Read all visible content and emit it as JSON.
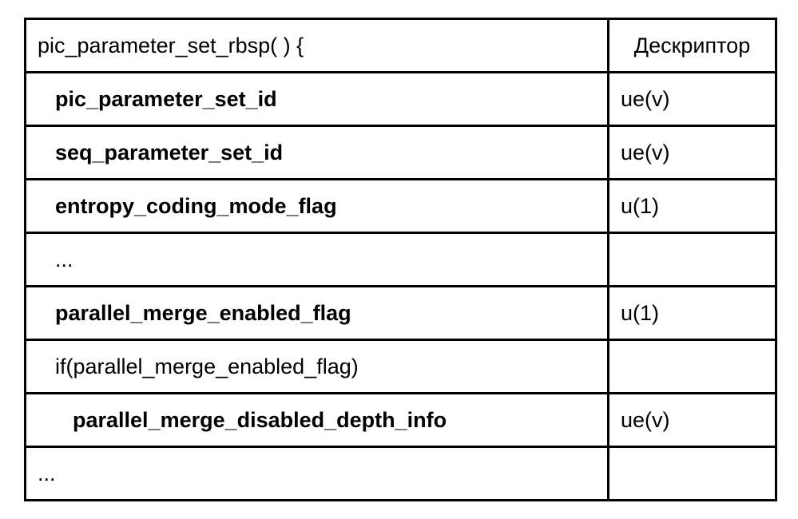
{
  "header": {
    "syntax": "pic_parameter_set_rbsp( ) {",
    "descriptor": "Дескриптор"
  },
  "rows": [
    {
      "syntax": "pic_parameter_set_id",
      "bold": true,
      "indent": 1,
      "descriptor": "ue(v)"
    },
    {
      "syntax": "seq_parameter_set_id",
      "bold": true,
      "indent": 1,
      "descriptor": "ue(v)"
    },
    {
      "syntax": "entropy_coding_mode_flag",
      "bold": true,
      "indent": 1,
      "descriptor": "u(1)"
    },
    {
      "syntax": "...",
      "bold": false,
      "indent": 1,
      "descriptor": ""
    },
    {
      "syntax": "parallel_merge_enabled_flag",
      "bold": true,
      "indent": 1,
      "descriptor": "u(1)"
    },
    {
      "syntax": "if(parallel_merge_enabled_flag)",
      "bold": false,
      "indent": 1,
      "descriptor": ""
    },
    {
      "syntax": "parallel_merge_disabled_depth_info",
      "bold": true,
      "indent": 2,
      "descriptor": "ue(v)"
    },
    {
      "syntax": "...",
      "bold": false,
      "indent": 0,
      "descriptor": ""
    }
  ]
}
